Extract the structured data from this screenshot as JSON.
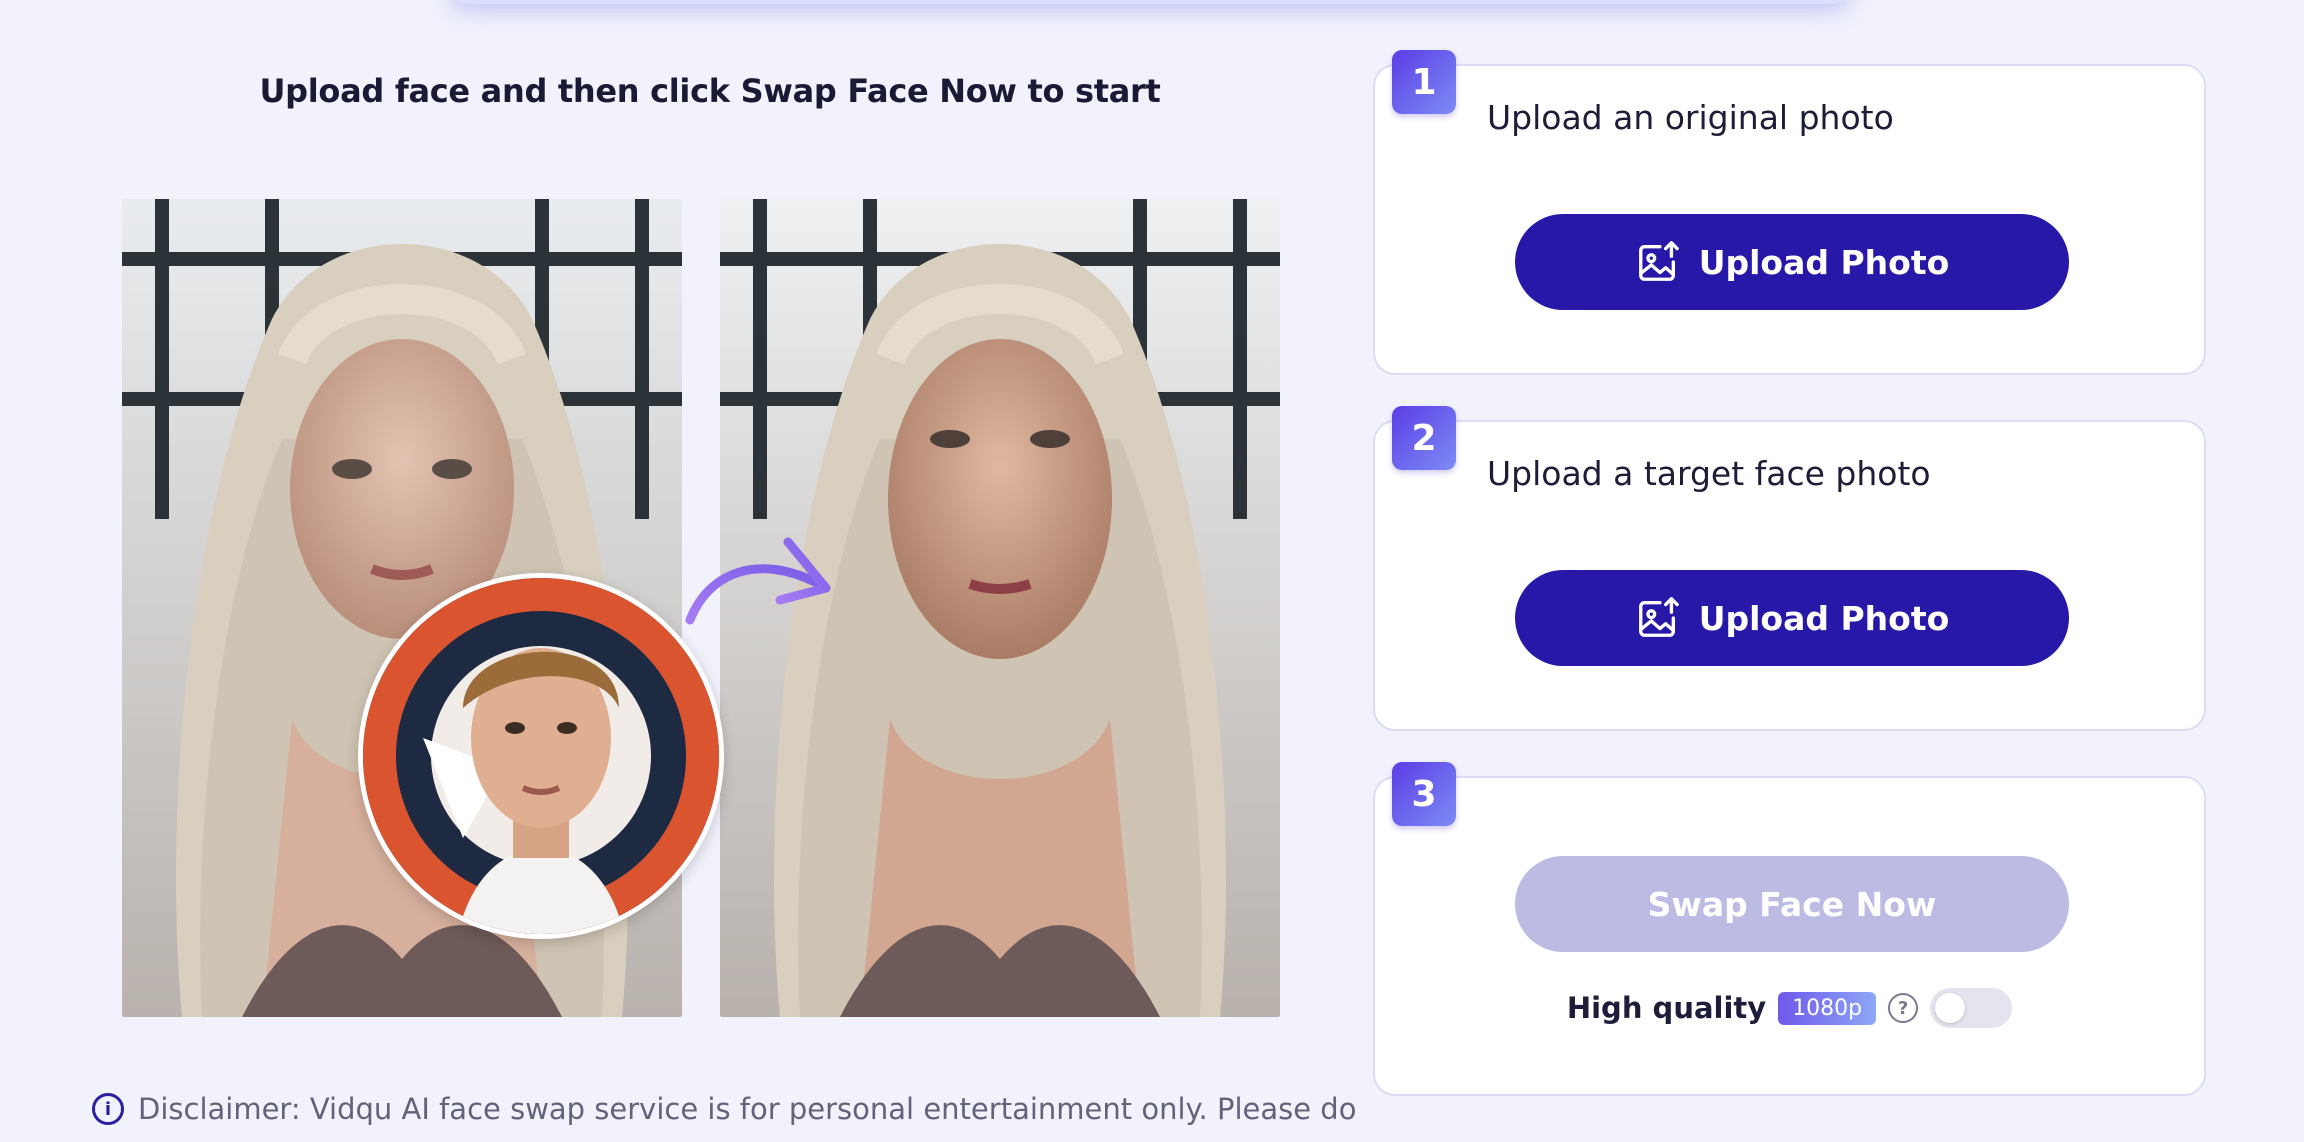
{
  "heading": "Upload face and then click Swap Face Now to start",
  "disclaimer": "Disclaimer: Vidqu AI face swap service is for personal entertainment only. Please do",
  "steps": [
    {
      "number": "1",
      "title": "Upload an original photo",
      "button_label": "Upload Photo"
    },
    {
      "number": "2",
      "title": "Upload a target face photo",
      "button_label": "Upload Photo"
    },
    {
      "number": "3",
      "button_label": "Swap Face Now"
    }
  ],
  "quality": {
    "label": "High quality",
    "resolution": "1080p",
    "help_symbol": "?",
    "toggle_on": false
  },
  "icons": {
    "info": "info-icon",
    "upload": "image-upload-icon",
    "help": "question-icon",
    "arrow": "curved-arrow-icon"
  },
  "colors": {
    "primary_button": "#2818a8",
    "disabled_button": "#bcbbe4",
    "badge_gradient_start": "#5b3de6",
    "badge_gradient_end": "#7d8cf5",
    "page_background": "#f1f2fc"
  }
}
